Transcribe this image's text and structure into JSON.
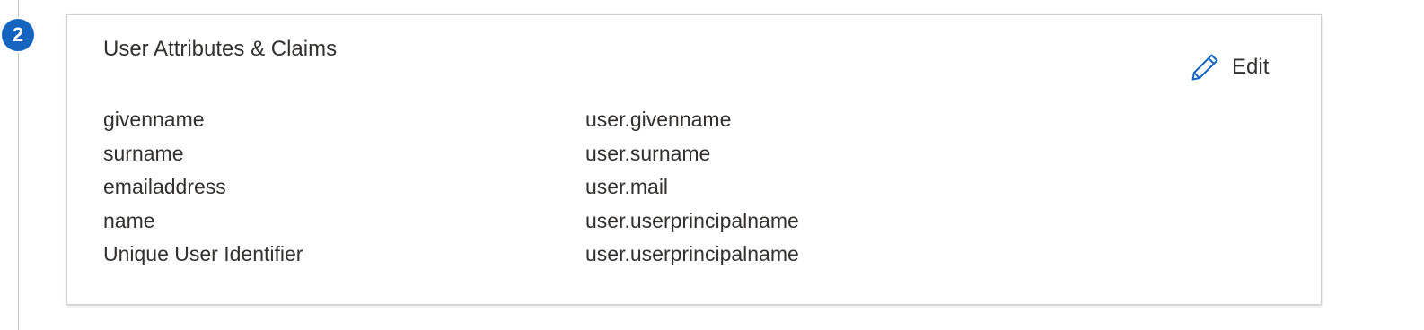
{
  "step": {
    "number": "2"
  },
  "section": {
    "title": "User Attributes & Claims",
    "edit_label": "Edit",
    "edit_icon": "pencil-icon",
    "accent_color": "#1565c0"
  },
  "claims": [
    {
      "name": "givenname",
      "value": "user.givenname"
    },
    {
      "name": "surname",
      "value": "user.surname"
    },
    {
      "name": "emailaddress",
      "value": "user.mail"
    },
    {
      "name": "name",
      "value": "user.userprincipalname"
    },
    {
      "name": "Unique User Identifier",
      "value": "user.userprincipalname"
    }
  ]
}
